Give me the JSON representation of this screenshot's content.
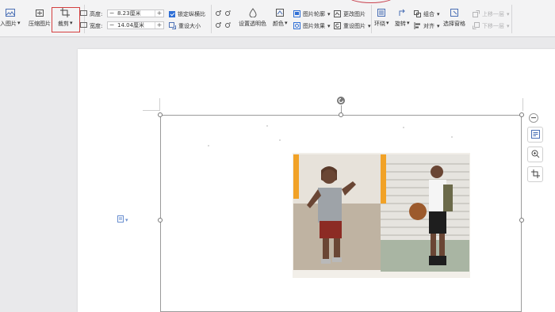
{
  "ribbon": {
    "insert_picture_label": "入图片",
    "compress_label": "压缩图片",
    "crop_label": "裁剪",
    "height_label": "高度:",
    "height_value": "8.23厘米",
    "width_label": "宽度:",
    "width_value": "14.04厘米",
    "lock_ratio_label": "锁定纵横比",
    "reset_size_label": "重设大小",
    "set_transparent_label": "设置透明色",
    "color_label": "颜色",
    "picture_outline_label": "图片轮廓",
    "picture_effect_label": "图片效果",
    "change_picture_label": "更改图片",
    "reset_picture_label": "重设图片",
    "wrap_label": "环绕",
    "rotate_label": "旋转",
    "group_label": "组合",
    "align_label": "对齐",
    "selection_pane_label": "选择窗格",
    "bring_forward_label": "上移一层",
    "send_backward_label": "下移一层",
    "dropdown_glyph": "▾",
    "minus_glyph": "−",
    "plus_glyph": "+"
  },
  "canvas": {
    "anchor_glyph": "▾"
  },
  "colors": {
    "accent": "#2f6fd6",
    "highlight_border": "#d43f3f",
    "ribbon_bg": "#f3f3f4",
    "canvas_bg": "#e9e9eb"
  },
  "icons": {
    "crop": "crop-icon",
    "compress": "compress-icon",
    "insert_picture": "insert-picture-icon",
    "rotate": "rotate-handle-icon",
    "zoom": "zoom-icon",
    "side_crop": "crop-icon"
  }
}
